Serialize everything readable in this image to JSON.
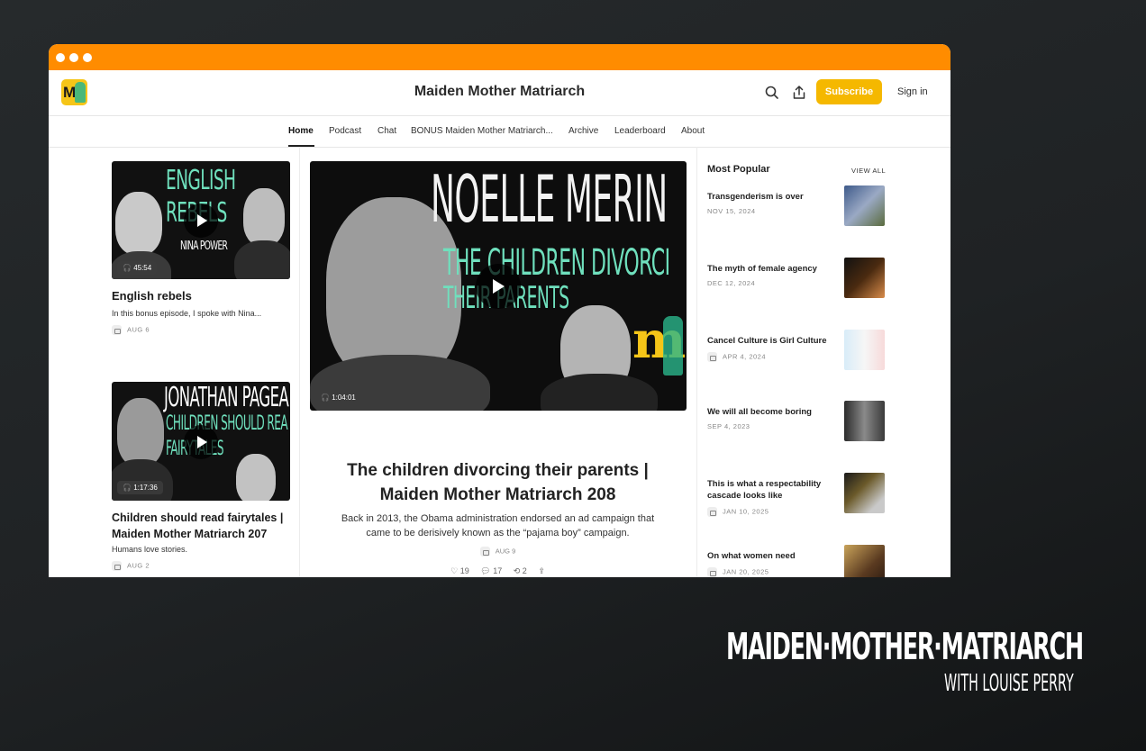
{
  "header": {
    "title": "Maiden Mother Matriarch",
    "subscribe": "Subscribe",
    "sign_in": "Sign in"
  },
  "nav": [
    "Home",
    "Podcast",
    "Chat",
    "BONUS Maiden Mother Matriarch...",
    "Archive",
    "Leaderboard",
    "About"
  ],
  "left_posts": [
    {
      "thumb_text": [
        "ENGLISH",
        "REBELS",
        "NINA POWER"
      ],
      "duration": "45:54",
      "title": "English rebels",
      "subtitle": "In this bonus episode, I spoke with Nina...",
      "date": "AUG 6"
    },
    {
      "thumb_text": [
        "JONATHAN PAGEA",
        "CHILDREN SHOULD REA",
        "FAIRYTALES"
      ],
      "duration": "1:17:36",
      "title": "Children should read fairytales | Maiden Mother Matriarch 207",
      "subtitle": "Humans love stories.",
      "date": "AUG 2"
    }
  ],
  "featured": {
    "thumb_text": [
      "NOELLE MERIN",
      "THE CHILDREN DIVORCI",
      "THEIR PARENTS"
    ],
    "duration": "1:04:01",
    "title": "The children divorcing their parents | Maiden Mother Matriarch 208",
    "subtitle": "Back in 2013, the Obama administration endorsed an ad campaign that came to be derisively known as the “pajama boy” campaign.",
    "date": "AUG 9",
    "likes": "19",
    "comments": "17",
    "restacks": "2"
  },
  "popular": {
    "heading": "Most Popular",
    "view_all": "VIEW ALL",
    "items": [
      {
        "title": "Transgenderism is over",
        "date": "NOV 15, 2024",
        "locked": false
      },
      {
        "title": "The myth of female agency",
        "date": "DEC 12, 2024",
        "locked": false
      },
      {
        "title": "Cancel Culture is Girl Culture",
        "date": "APR 4, 2024",
        "locked": true
      },
      {
        "title": "We will all become boring",
        "date": "SEP 4, 2023",
        "locked": false
      },
      {
        "title": "This is what a respectability cascade looks like",
        "date": "JAN 10, 2025",
        "locked": true
      },
      {
        "title": "On what women need",
        "date": "JAN 20, 2025",
        "locked": true
      }
    ]
  },
  "brand": {
    "main": "MAIDEN·MOTHER·MATRIARCH",
    "sub": "WITH LOUISE PERRY"
  },
  "colors": {
    "titlebar": "#ff8c00",
    "subscribe": "#f5b800",
    "accent_teal": "#6fe0bd"
  }
}
